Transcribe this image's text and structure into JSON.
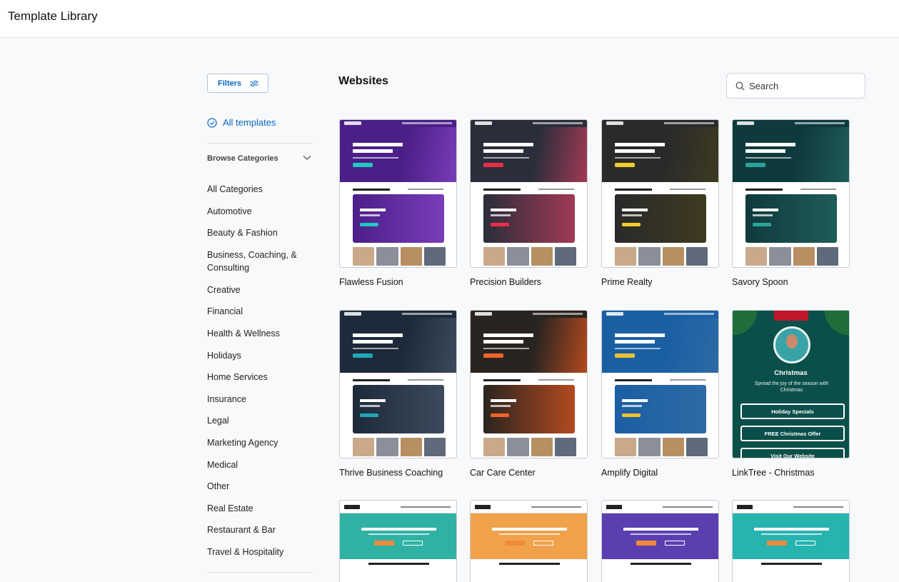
{
  "header": {
    "title": "Template Library"
  },
  "sidebar": {
    "filters_label": "Filters",
    "all_templates_label": "All templates",
    "browse_label": "Browse Categories",
    "categories": [
      "All Categories",
      "Automotive",
      "Beauty & Fashion",
      "Business, Coaching, & Consulting",
      "Creative",
      "Financial",
      "Health & Wellness",
      "Holidays",
      "Home Services",
      "Insurance",
      "Legal",
      "Marketing Agency",
      "Medical",
      "Other",
      "Real Estate",
      "Restaurant & Bar",
      "Travel & Hospitality"
    ]
  },
  "main": {
    "section_title": "Websites",
    "search_label": "Search",
    "templates": [
      {
        "name": "Flawless Fusion",
        "accent": "#4b1f88",
        "cta": "#1fc8c2",
        "panel": "#7a3cb8"
      },
      {
        "name": "Precision Builders",
        "accent": "#2a2d3a",
        "cta": "#ea2e47",
        "panel": "#a13a55"
      },
      {
        "name": "Prime Realty",
        "accent": "#2a2a2a",
        "cta": "#f0cd2e",
        "panel": "#3e3a20"
      },
      {
        "name": "Savory Spoon",
        "accent": "#0f3a3d",
        "cta": "#2aa39a",
        "panel": "#1f5c58"
      },
      {
        "name": "Thrive Business Coaching",
        "accent": "#1d2a3a",
        "cta": "#1fa7b6",
        "panel": "#3b4a5c"
      },
      {
        "name": "Car Care Center",
        "accent": "#2a2420",
        "cta": "#f1652a",
        "panel": "#b34a1f"
      },
      {
        "name": "Amplify Digital",
        "accent": "#1b5fa3",
        "cta": "#f1c232",
        "panel": "#2c6aa4"
      },
      {
        "name": "LinkTree - Christmas"
      }
    ],
    "christmas": {
      "title": "Christmas",
      "subtitle": "Spread the joy of the season with Christmas",
      "buttons": [
        "Holiday Specials",
        "FREE Christmas Offer",
        "Visit Our Website"
      ]
    },
    "row3": [
      {
        "name": "",
        "hero": "#2fb2a4"
      },
      {
        "name": "",
        "hero": "#f0a24a"
      },
      {
        "name": "",
        "hero": "#5b3fb0"
      },
      {
        "name": "",
        "hero": "#27b3b0"
      }
    ]
  }
}
